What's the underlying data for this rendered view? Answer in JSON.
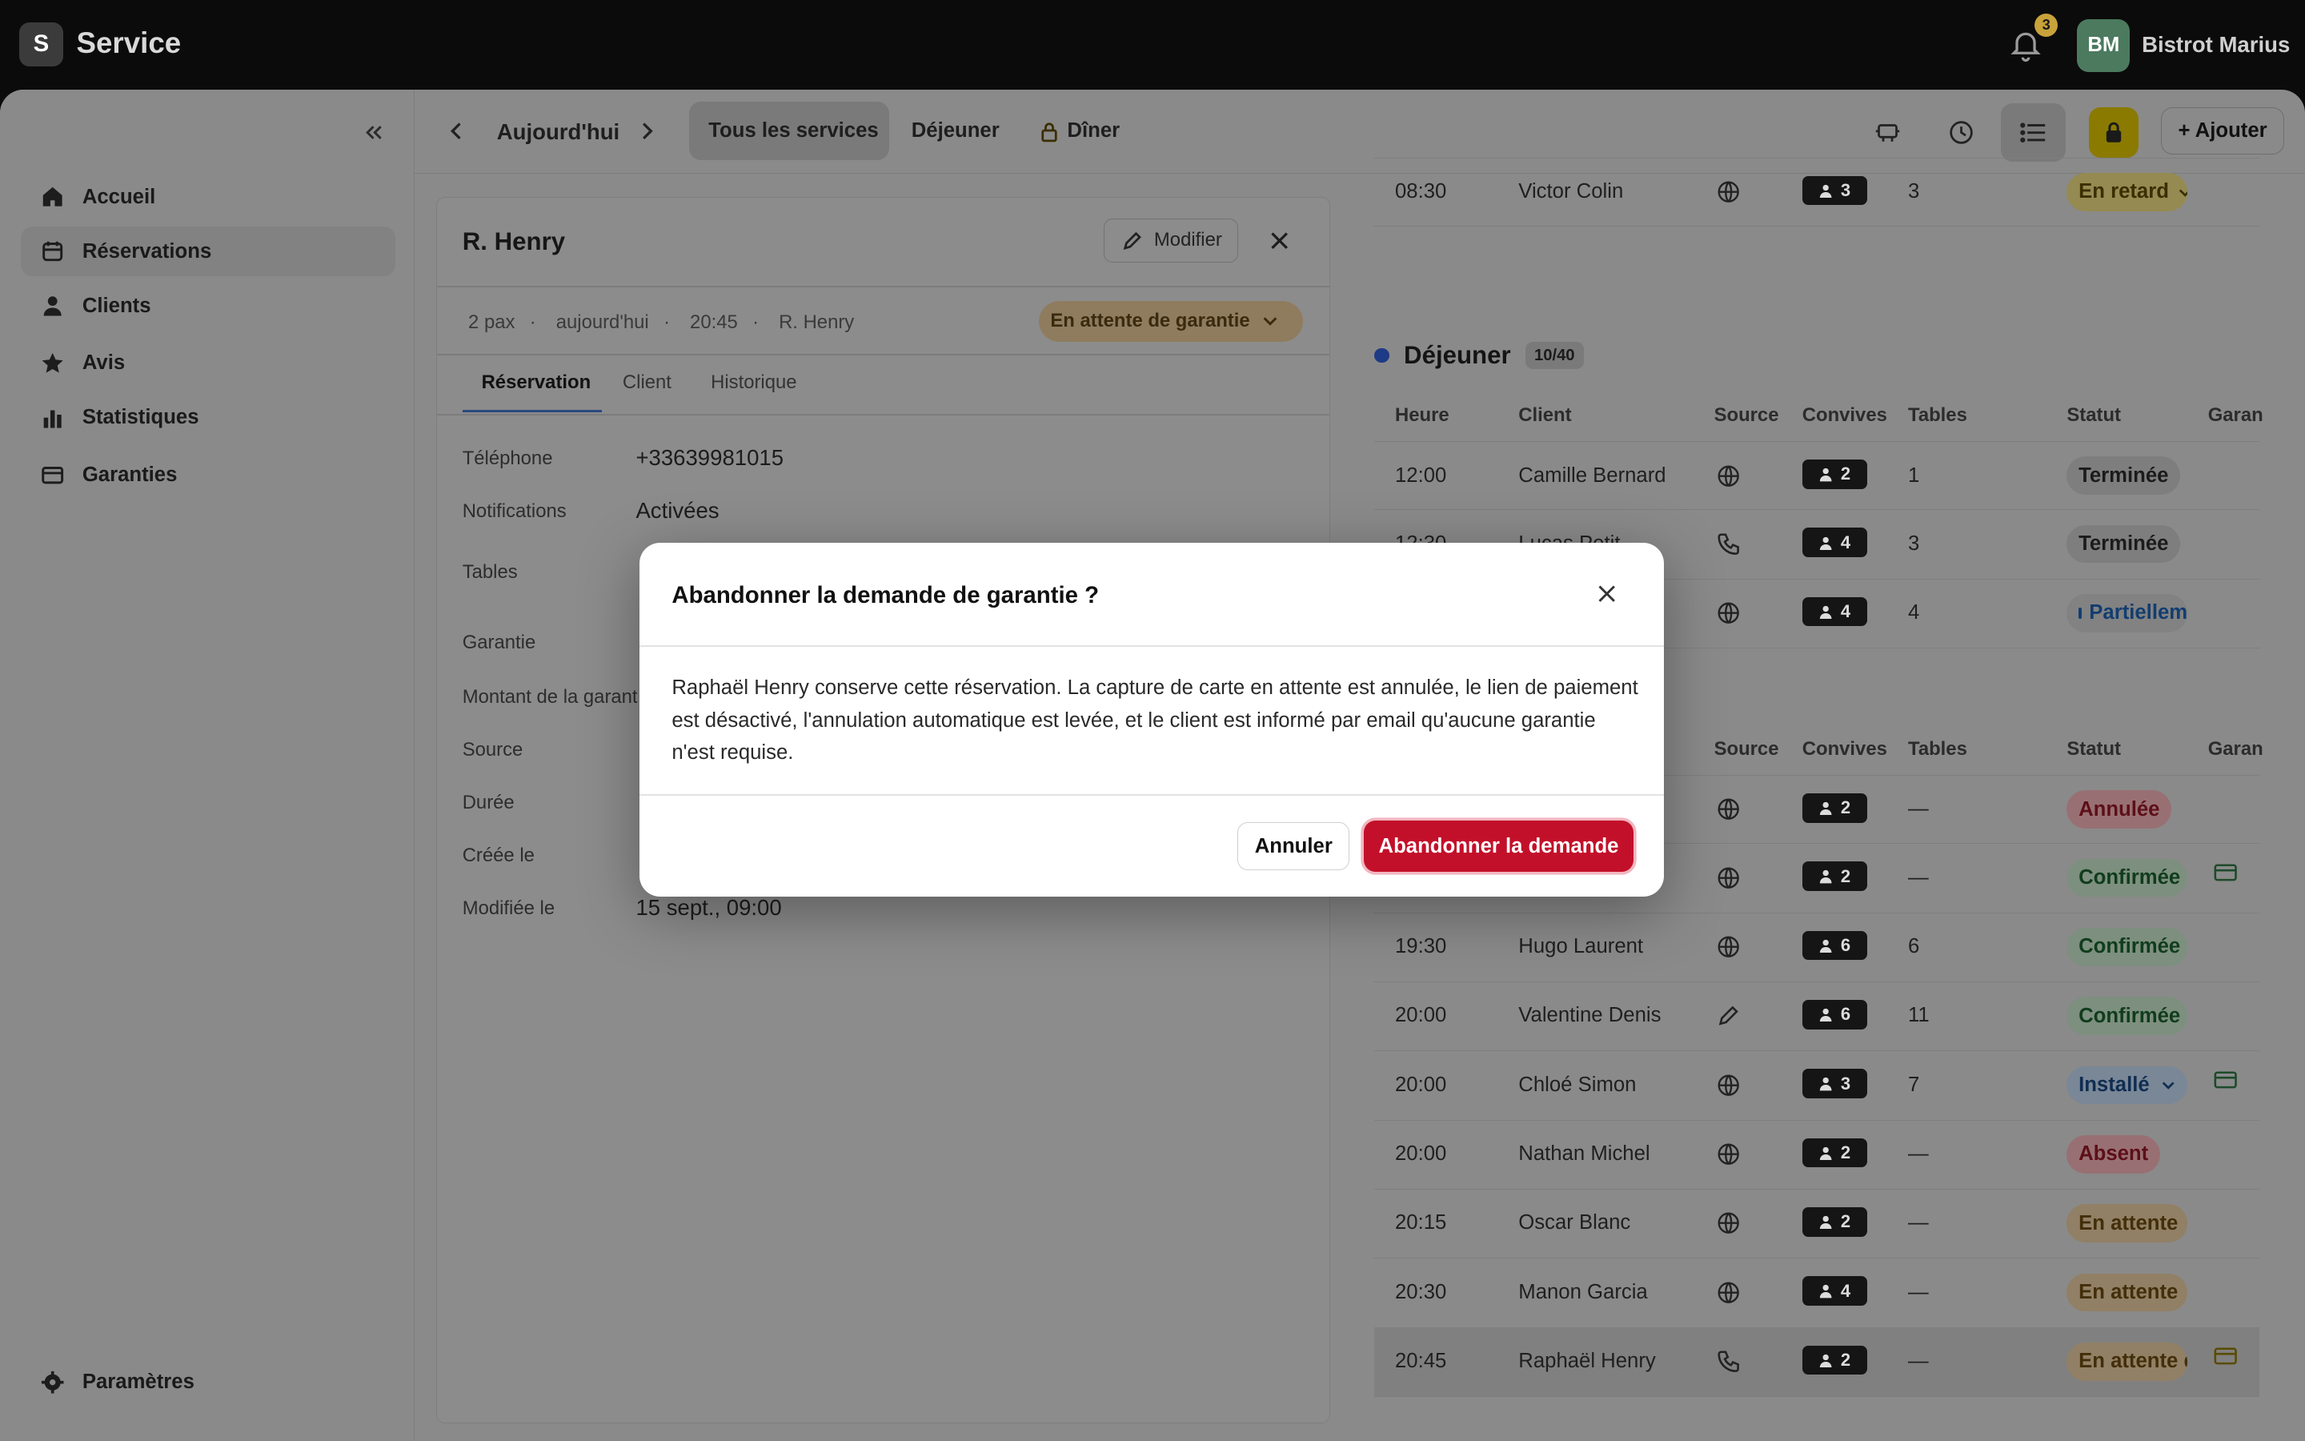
{
  "app": {
    "logo_letter": "S",
    "title": "Service",
    "notif_count": "3",
    "avatar_initials": "BM",
    "venue": "Bistrot Marius"
  },
  "sidebar": {
    "items": [
      {
        "label": "Accueil",
        "icon": "home-icon"
      },
      {
        "label": "Réservations",
        "icon": "calendar-icon",
        "active": true
      },
      {
        "label": "Clients",
        "icon": "user-icon"
      },
      {
        "label": "Avis",
        "icon": "star-icon"
      },
      {
        "label": "Statistiques",
        "icon": "bar-chart-icon"
      },
      {
        "label": "Garanties",
        "icon": "card-icon"
      }
    ],
    "settings_label": "Paramètres"
  },
  "toolbar": {
    "date_label": "Aujourd'hui",
    "services": [
      "Tous les services",
      "Déjeuner",
      "Dîner"
    ],
    "add_label": "+ Ajouter"
  },
  "detail": {
    "name": "R. Henry",
    "edit_label": "Modifier",
    "meta": [
      "2 pax",
      "aujourd'hui",
      "20:45",
      "R. Henry"
    ],
    "status": "En attente de garantie",
    "tabs": [
      "Réservation",
      "Client",
      "Historique"
    ],
    "fields": [
      {
        "label": "Téléphone",
        "value": "+33639981015"
      },
      {
        "label": "Notifications",
        "value": "Activées"
      },
      {
        "label": "Tables",
        "value": ""
      },
      {
        "label": "Garantie",
        "value": ""
      },
      {
        "label": "Montant de la garant",
        "value": ""
      },
      {
        "label": "Source",
        "value": ""
      },
      {
        "label": "Durée",
        "value": ""
      },
      {
        "label": "Créée le",
        "value": ""
      },
      {
        "label": "Modifiée le",
        "value": "15 sept., 09:00"
      }
    ]
  },
  "list": {
    "headers": [
      "Heure",
      "Client",
      "Source",
      "Convives",
      "Tables",
      "Statut",
      "Garan"
    ],
    "lunch": {
      "name": "Déjeuner",
      "count": "10/40"
    },
    "top_row": {
      "time": "08:30",
      "client": "Victor Colin",
      "pax": "3",
      "tables": "3",
      "status": "En retard"
    },
    "lunch_rows": [
      {
        "time": "12:00",
        "client": "Camille Bernard",
        "pax": "2",
        "tables": "1",
        "status": "Terminée"
      },
      {
        "time": "12:30",
        "client": "Lucas Petit",
        "pax": "4",
        "tables": "3",
        "status": "Terminée"
      },
      {
        "time": "",
        "client": "",
        "pax": "4",
        "tables": "4",
        "status": "Partiellement"
      }
    ],
    "dinner_rows": [
      {
        "time": "",
        "client": "",
        "pax": "2",
        "tables": "—",
        "status": "Annulée"
      },
      {
        "time": "",
        "client": "",
        "pax": "2",
        "tables": "—",
        "status": "Confirmée"
      },
      {
        "time": "19:30",
        "client": "Hugo Laurent",
        "pax": "6",
        "tables": "6",
        "status": "Confirmée"
      },
      {
        "time": "20:00",
        "client": "Valentine Denis",
        "pax": "6",
        "tables": "11",
        "status": "Confirmée"
      },
      {
        "time": "20:00",
        "client": "Chloé Simon",
        "pax": "3",
        "tables": "7",
        "status": "Installé"
      },
      {
        "time": "20:00",
        "client": "Nathan Michel",
        "pax": "2",
        "tables": "—",
        "status": "Absent"
      },
      {
        "time": "20:15",
        "client": "Oscar Blanc",
        "pax": "2",
        "tables": "—",
        "status": "En attente"
      },
      {
        "time": "20:30",
        "client": "Manon Garcia",
        "pax": "4",
        "tables": "—",
        "status": "En attente"
      },
      {
        "time": "20:45",
        "client": "Raphaël Henry",
        "pax": "2",
        "tables": "—",
        "status": "En attente de garantie"
      }
    ]
  },
  "modal": {
    "title": "Abandonner la demande de garantie ?",
    "body": "Raphaël Henry conserve cette réservation. La capture de carte en attente est annulée, le lien de paiement est désactivé, l'annulation automatique est levée, et le client est informé par email qu'aucune garantie n'est requise.",
    "cancel_label": "Annuler",
    "confirm_label": "Abandonner la demande"
  },
  "colors": {
    "primary_danger": "#c3102a",
    "avatar_bg": "#4c7a5f",
    "accent": "#c8a23a"
  }
}
